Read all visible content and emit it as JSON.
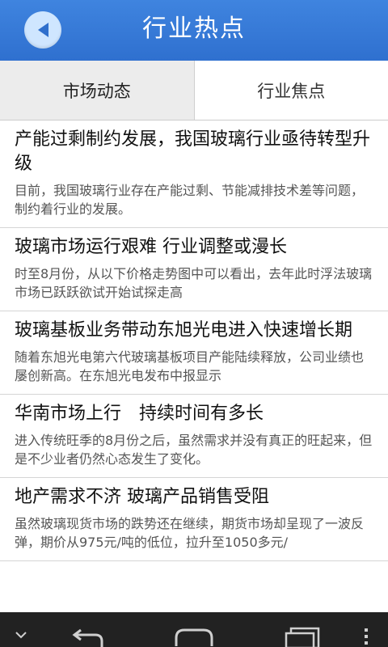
{
  "header": {
    "title": "行业热点",
    "back_icon": "back-arrow-icon"
  },
  "tabs": [
    {
      "label": "市场动态",
      "active": true
    },
    {
      "label": "行业焦点",
      "active": false
    }
  ],
  "articles": [
    {
      "title": "产能过剩制约发展，我国玻璃行业亟待转型升级",
      "summary": "目前，我国玻璃行业存在产能过剩、节能减排技术差等问题，制约着行业的发展。"
    },
    {
      "title": "玻璃市场运行艰难 行业调整或漫长",
      "summary": "时至8月份，从以下价格走势图中可以看出，去年此时浮法玻璃市场已跃跃欲试开始试探走高"
    },
    {
      "title": "玻璃基板业务带动东旭光电进入快速增长期",
      "summary": "随着东旭光电第六代玻璃基板项目产能陆续释放，公司业绩也屡创新高。在东旭光电发布中报显示"
    },
    {
      "title": "华南市场上行　持续时间有多长",
      "summary": "进入传统旺季的8月份之后，虽然需求并没有真正的旺起来，但是不少业者仍然心态发生了变化。"
    },
    {
      "title": "地产需求不济 玻璃产品销售受阻",
      "summary": "虽然玻璃现货市场的跌势还在继续，期货市场却呈现了一波反弹，期价从975元/吨的低位，拉升至1050多元/"
    }
  ],
  "navbar": {
    "icons": [
      "chevron-down-icon",
      "back-icon",
      "home-icon",
      "recent-apps-icon",
      "menu-icon"
    ]
  }
}
